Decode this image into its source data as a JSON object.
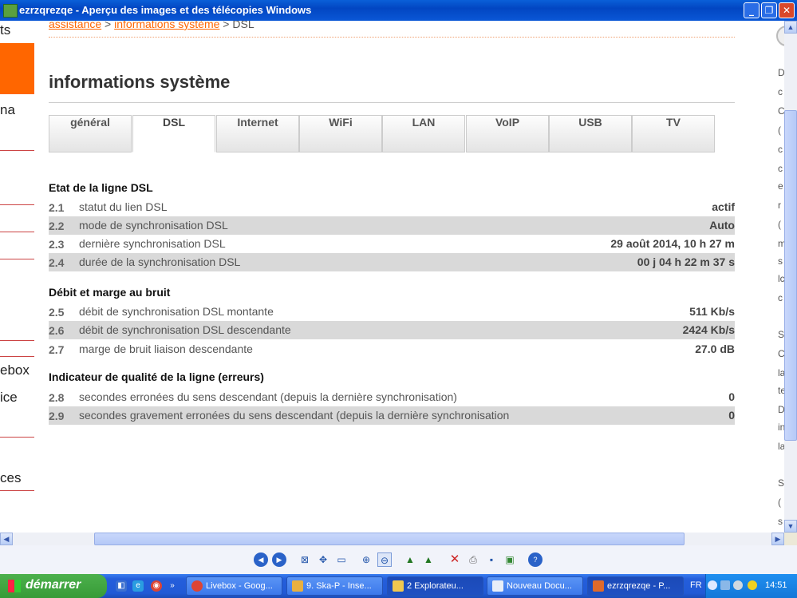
{
  "window": {
    "title": "ezrzqrezqe - Aperçu des images et des télécopies Windows",
    "minimize": "_",
    "maximize": "❐",
    "close": "✕"
  },
  "left_nav": {
    "items": [
      "ts",
      "na",
      "ebox",
      "ice",
      "ces"
    ]
  },
  "breadcrumb": {
    "link1": "assistance",
    "sep1": " > ",
    "link2": "informations système",
    "sep2": " > ",
    "current": "DSL"
  },
  "page": {
    "title": "informations système"
  },
  "tabs": [
    {
      "label": "général"
    },
    {
      "label": "DSL"
    },
    {
      "label": "Internet"
    },
    {
      "label": "WiFi"
    },
    {
      "label": "LAN"
    },
    {
      "label": "VoIP"
    },
    {
      "label": "USB"
    },
    {
      "label": "TV"
    }
  ],
  "sections": [
    {
      "title": "Etat de la ligne DSL",
      "rows": [
        {
          "num": "2.1",
          "label": "statut du lien DSL",
          "value": "actif"
        },
        {
          "num": "2.2",
          "label": "mode de synchronisation DSL",
          "value": "Auto"
        },
        {
          "num": "2.3",
          "label": "dernière synchronisation DSL",
          "value": "29 août 2014, 10 h 27 m"
        },
        {
          "num": "2.4",
          "label": "durée de la synchronisation DSL",
          "value": "00 j 04 h 22 m 37 s"
        }
      ]
    },
    {
      "title": "Débit et marge au bruit",
      "rows": [
        {
          "num": "2.5",
          "label": "débit de synchronisation DSL montante",
          "value": "511 Kb/s"
        },
        {
          "num": "2.6",
          "label": "débit de synchronisation DSL descendante",
          "value": "2424 Kb/s"
        },
        {
          "num": "2.7",
          "label": "marge de bruit liaison descendante",
          "value": "27.0 dB"
        }
      ]
    },
    {
      "title": "Indicateur de qualité de la ligne (erreurs)",
      "rows": [
        {
          "num": "2.8",
          "label": "secondes erronées du sens descendant (depuis la dernière synchronisation)",
          "value": "0"
        },
        {
          "num": "2.9",
          "label": "secondes gravement erronées du sens descendant (depuis la dernière synchronisation",
          "value": "0"
        }
      ]
    }
  ],
  "right_panel": {
    "letters": [
      "D",
      "c",
      "C",
      "(",
      "c",
      "c",
      "e",
      "r",
      "(",
      "m",
      "s",
      "lc",
      "c",
      "S",
      "C",
      "la",
      "te",
      "D",
      "in",
      "la",
      "S",
      "(",
      "s"
    ]
  },
  "taskbar": {
    "start": "démarrer",
    "tasks": [
      "Livebox - Goog...",
      "9. Ska-P - Inse...",
      "2 Explorateu...",
      "Nouveau Docu...",
      "ezrzqrezqe - P..."
    ],
    "lang": "FR",
    "clock": "14:51"
  },
  "colors": {
    "accent": "#ff6600",
    "row_shade": "#d9d9d9",
    "taskbar": "#245edb",
    "start": "#379b37"
  }
}
